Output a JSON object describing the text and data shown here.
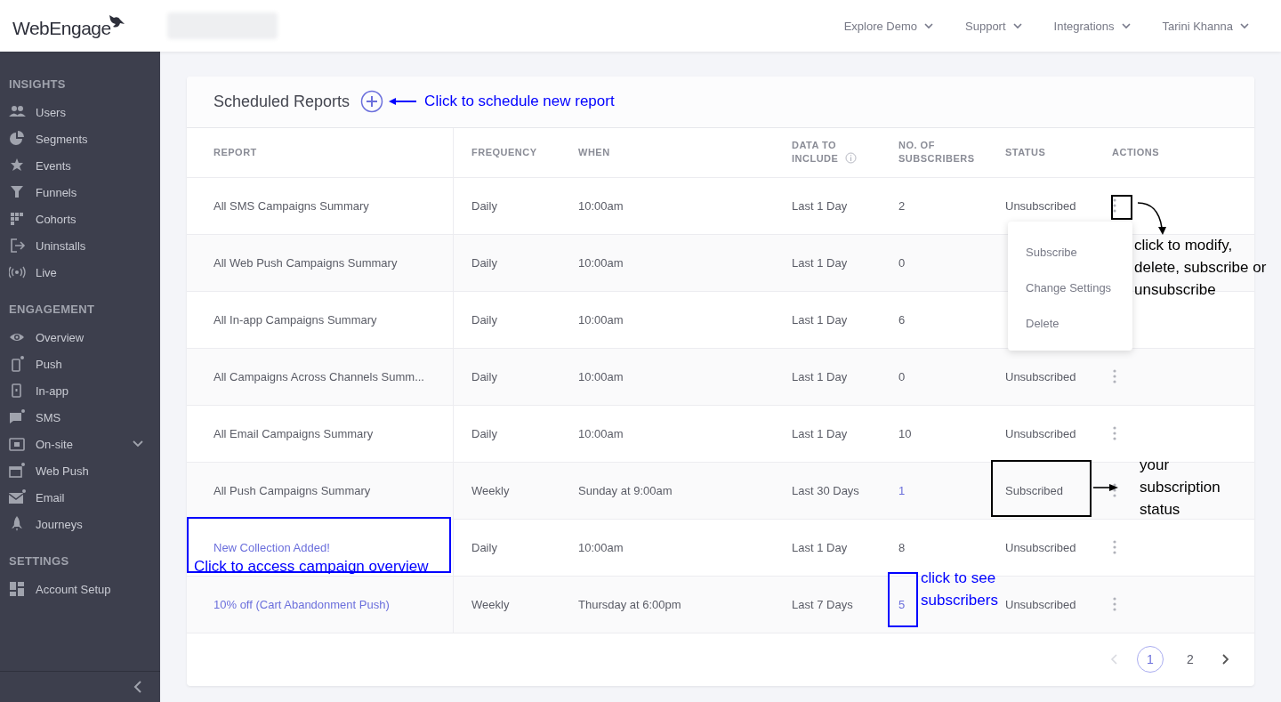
{
  "header": {
    "logo": "WebEngage",
    "nav": [
      {
        "label": "Explore Demo"
      },
      {
        "label": "Support"
      },
      {
        "label": "Integrations"
      },
      {
        "label": "Tarini Khanna"
      }
    ]
  },
  "sidebar": {
    "sections": [
      {
        "title": "INSIGHTS",
        "items": [
          {
            "label": "Users",
            "expandable": false
          },
          {
            "label": "Segments",
            "expandable": false
          },
          {
            "label": "Events",
            "expandable": false
          },
          {
            "label": "Funnels",
            "expandable": false
          },
          {
            "label": "Cohorts",
            "expandable": false
          },
          {
            "label": "Uninstalls",
            "expandable": false
          },
          {
            "label": "Live",
            "expandable": false
          }
        ]
      },
      {
        "title": "ENGAGEMENT",
        "items": [
          {
            "label": "Overview",
            "expandable": false
          },
          {
            "label": "Push",
            "expandable": false
          },
          {
            "label": "In-app",
            "expandable": false
          },
          {
            "label": "SMS",
            "expandable": false
          },
          {
            "label": "On-site",
            "expandable": true
          },
          {
            "label": "Web Push",
            "expandable": false
          },
          {
            "label": "Email",
            "expandable": false
          },
          {
            "label": "Journeys",
            "expandable": false
          }
        ]
      },
      {
        "title": "SETTINGS",
        "items": [
          {
            "label": "Account Setup",
            "expandable": false
          }
        ]
      }
    ]
  },
  "card": {
    "title": "Scheduled Reports",
    "hint": "Click to schedule new report"
  },
  "table": {
    "columns": [
      {
        "label": "REPORT"
      },
      {
        "label": "FREQUENCY"
      },
      {
        "label": "WHEN"
      },
      {
        "label": "DATA TO INCLUDE",
        "info": true
      },
      {
        "label": "NO. OF SUBSCRIBERS",
        "info": false
      },
      {
        "label": "STATUS"
      },
      {
        "label": "ACTIONS"
      }
    ],
    "rows": [
      {
        "report": "All SMS Campaigns Summary",
        "report_linked": false,
        "frequency": "Daily",
        "when": "10:00am",
        "data": "Last 1 Day",
        "subscribers": "2",
        "subscribers_linked": false,
        "status": "Unsubscribed",
        "actions_menu": true
      },
      {
        "report": "All Web Push Campaigns Summary",
        "report_linked": false,
        "frequency": "Daily",
        "when": "10:00am",
        "data": "Last 1 Day",
        "subscribers": "0",
        "subscribers_linked": false,
        "actions_menu": false
      },
      {
        "report": "All In-app Campaigns Summary",
        "report_linked": false,
        "frequency": "Daily",
        "when": "10:00am",
        "data": "Last 1 Day",
        "subscribers": "6",
        "subscribers_linked": false,
        "actions_menu": false
      },
      {
        "report": "All Campaigns Across Channels Summ...",
        "report_linked": false,
        "frequency": "Daily",
        "when": "10:00am",
        "data": "Last 1 Day",
        "subscribers": "0",
        "subscribers_linked": false,
        "status": "Unsubscribed",
        "actions_menu": true
      },
      {
        "report": "All Email Campaigns Summary",
        "report_linked": false,
        "frequency": "Daily",
        "when": "10:00am",
        "data": "Last 1 Day",
        "subscribers": "10",
        "subscribers_linked": false,
        "status": "Unsubscribed",
        "actions_menu": true
      },
      {
        "report": "All Push Campaigns Summary",
        "report_linked": false,
        "frequency": "Weekly",
        "when": "Sunday at 9:00am",
        "data": "Last 30 Days",
        "subscribers": "1",
        "subscribers_linked": true,
        "status": "Subscribed",
        "actions_menu": true
      },
      {
        "report": "New Collection Added!",
        "report_linked": true,
        "frequency": "Daily",
        "when": "10:00am",
        "data": "Last 1 Day",
        "subscribers": "8",
        "subscribers_linked": false,
        "status": "Unsubscribed",
        "actions_menu": true
      },
      {
        "report": "10% off (Cart Abandonment Push)",
        "report_linked": true,
        "frequency": "Weekly",
        "when": "Thursday at 6:00pm",
        "data": "Last 7 Days",
        "subscribers": "5",
        "subscribers_linked": true,
        "status": "Unsubscribed",
        "actions_menu": true
      }
    ]
  },
  "actions_menu": {
    "items": [
      {
        "label": "Subscribe"
      },
      {
        "label": "Change Settings"
      },
      {
        "label": "Delete"
      }
    ]
  },
  "pagination": {
    "pages": [
      {
        "label": "1",
        "selected": true
      },
      {
        "label": "2",
        "selected": false
      }
    ],
    "prev_disabled": true
  },
  "annotations": [
    {
      "kind": "box",
      "color": "#000000"
    },
    {
      "kind": "curved-arrow",
      "color": "#000000"
    },
    {
      "kind": "note",
      "text": "click to modify, delete, subscribe or unsubscribe",
      "color": "#000000"
    },
    {
      "kind": "box",
      "color": "#000000"
    },
    {
      "kind": "arrow",
      "color": "#000000"
    },
    {
      "kind": "note",
      "text": "your subscription status",
      "color": "#000000"
    },
    {
      "kind": "box",
      "color": "#0000ff"
    },
    {
      "kind": "note",
      "text": "Click to access campaign overview",
      "color": "#0000ff"
    },
    {
      "kind": "box",
      "color": "#0000ff"
    },
    {
      "kind": "note",
      "text": "click to see subscribers",
      "color": "#0000ff"
    }
  ]
}
